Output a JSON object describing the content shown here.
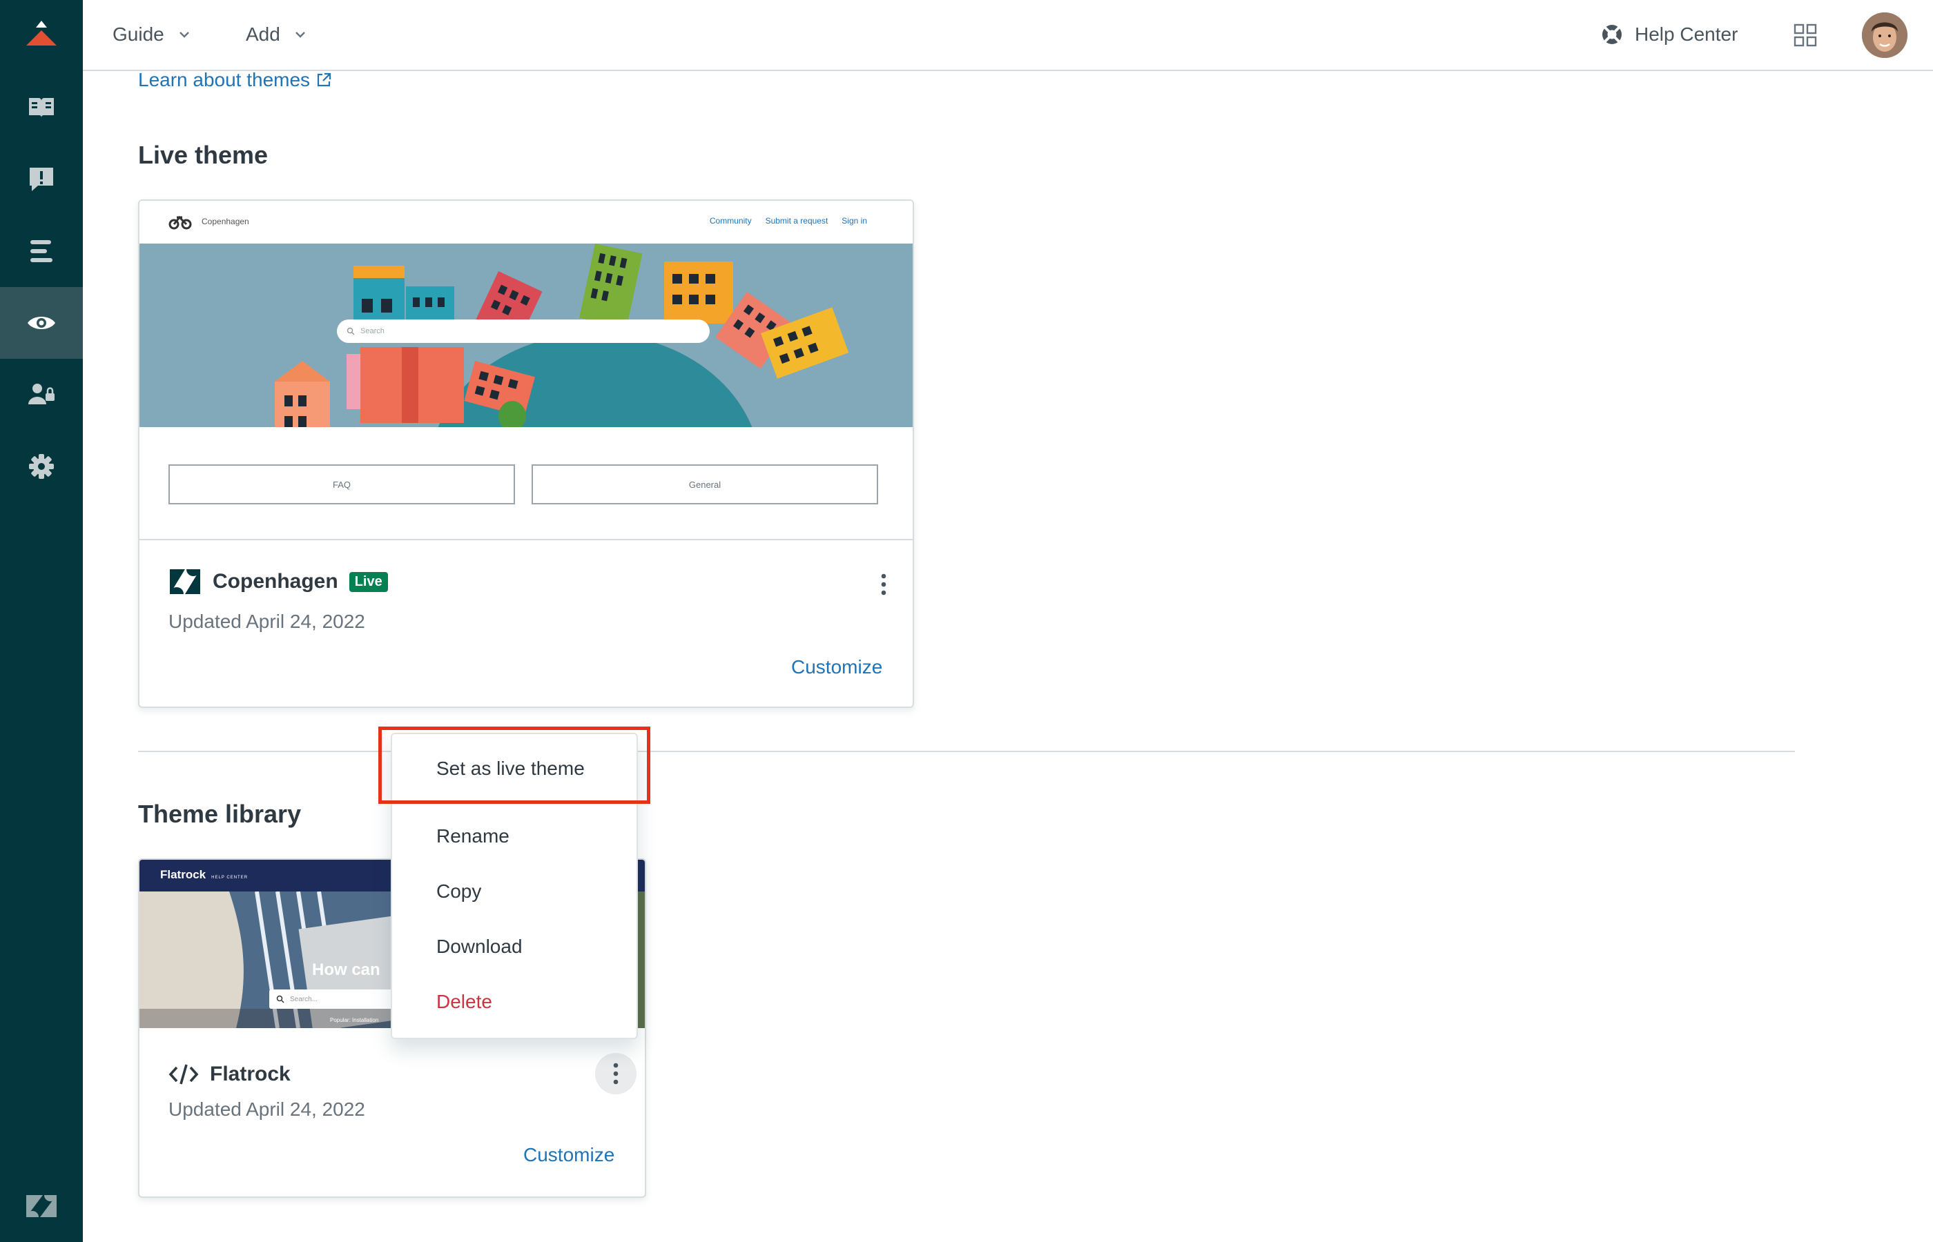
{
  "topbar": {
    "menus": [
      {
        "label": "Guide"
      },
      {
        "label": "Add"
      }
    ],
    "help_center_label": "Help Center"
  },
  "sidebar": {
    "items": [
      {
        "icon": "book-icon",
        "active": false
      },
      {
        "icon": "alert-icon",
        "active": false
      },
      {
        "icon": "list-icon",
        "active": false
      },
      {
        "icon": "eye-icon",
        "active": true
      },
      {
        "icon": "user-lock-icon",
        "active": false
      },
      {
        "icon": "gear-icon",
        "active": false
      }
    ]
  },
  "main": {
    "learn_link": "Learn about themes",
    "live_section_title": "Live theme",
    "library_section_title": "Theme library"
  },
  "live_theme": {
    "name": "Copenhagen",
    "badge": "Live",
    "updated": "Updated April 24, 2022",
    "customize_label": "Customize",
    "preview": {
      "brand": "Copenhagen",
      "nav_links": [
        "Community",
        "Submit a request",
        "Sign in"
      ],
      "search_placeholder": "Search",
      "categories": [
        "FAQ",
        "General"
      ]
    }
  },
  "library_theme": {
    "name": "Flatrock",
    "updated": "Updated April 24, 2022",
    "customize_label": "Customize",
    "preview": {
      "brand": "Flatrock",
      "brand_sub": "HELP CENTER",
      "headline": "How can",
      "search_placeholder": "Search...",
      "popular": "Popular: Installation"
    }
  },
  "menu": {
    "items": [
      "Set as live theme",
      "Rename",
      "Copy",
      "Download",
      "Delete"
    ],
    "highlighted": "Set as live theme",
    "highlight_color": "#e8311a"
  },
  "colors": {
    "sidebar": "#03363d",
    "sidebar_active": "#30545a",
    "link": "#1f73b7",
    "live_badge": "#038153",
    "danger": "#cc3340"
  }
}
